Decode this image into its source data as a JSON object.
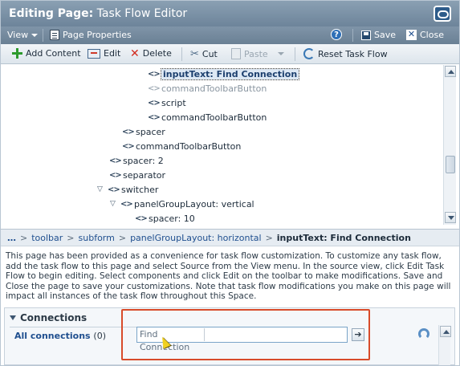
{
  "titlebar": {
    "prefix": "Editing Page:",
    "title": "Task Flow Editor"
  },
  "menubar": {
    "view": "View",
    "page_properties": "Page Properties",
    "save": "Save",
    "close": "Close"
  },
  "toolbar": {
    "add_content": "Add Content",
    "edit": "Edit",
    "delete": "Delete",
    "cut": "Cut",
    "paste": "Paste",
    "reset": "Reset Task Flow"
  },
  "tree": {
    "nodes": [
      {
        "label": "inputText: Find Connection"
      },
      {
        "label": "commandToolbarButton"
      },
      {
        "label": "script"
      },
      {
        "label": "commandToolbarButton"
      },
      {
        "label": "spacer"
      },
      {
        "label": "commandToolbarButton"
      },
      {
        "label": "spacer: 2"
      },
      {
        "label": "separator"
      },
      {
        "label": "switcher"
      },
      {
        "label": "panelGroupLayout: vertical"
      },
      {
        "label": "spacer: 10"
      }
    ],
    "tag_glyph": "<>",
    "twisty_glyph": "▽"
  },
  "breadcrumb": {
    "dots": "…",
    "sep": ">",
    "items": [
      "toolbar",
      "subform",
      "panelGroupLayout: horizontal",
      "inputText: Find Connection"
    ]
  },
  "help_text": "This page has been provided as a convenience for task flow customization. To customize any task flow, add the task flow to this page and select Source from the View menu. In the source view, click Edit Task Flow to begin editing. Select components and click Edit on the toolbar to make modifications. Save and Close the page to save your customizations. Note that task flow modifications you make on this page will impact all instances of the task flow throughout this Space.",
  "connections": {
    "title": "Connections",
    "all_label": "All connections",
    "all_count": "(0)",
    "search_placeholder": "Find Connection",
    "go_glyph": "➔"
  }
}
